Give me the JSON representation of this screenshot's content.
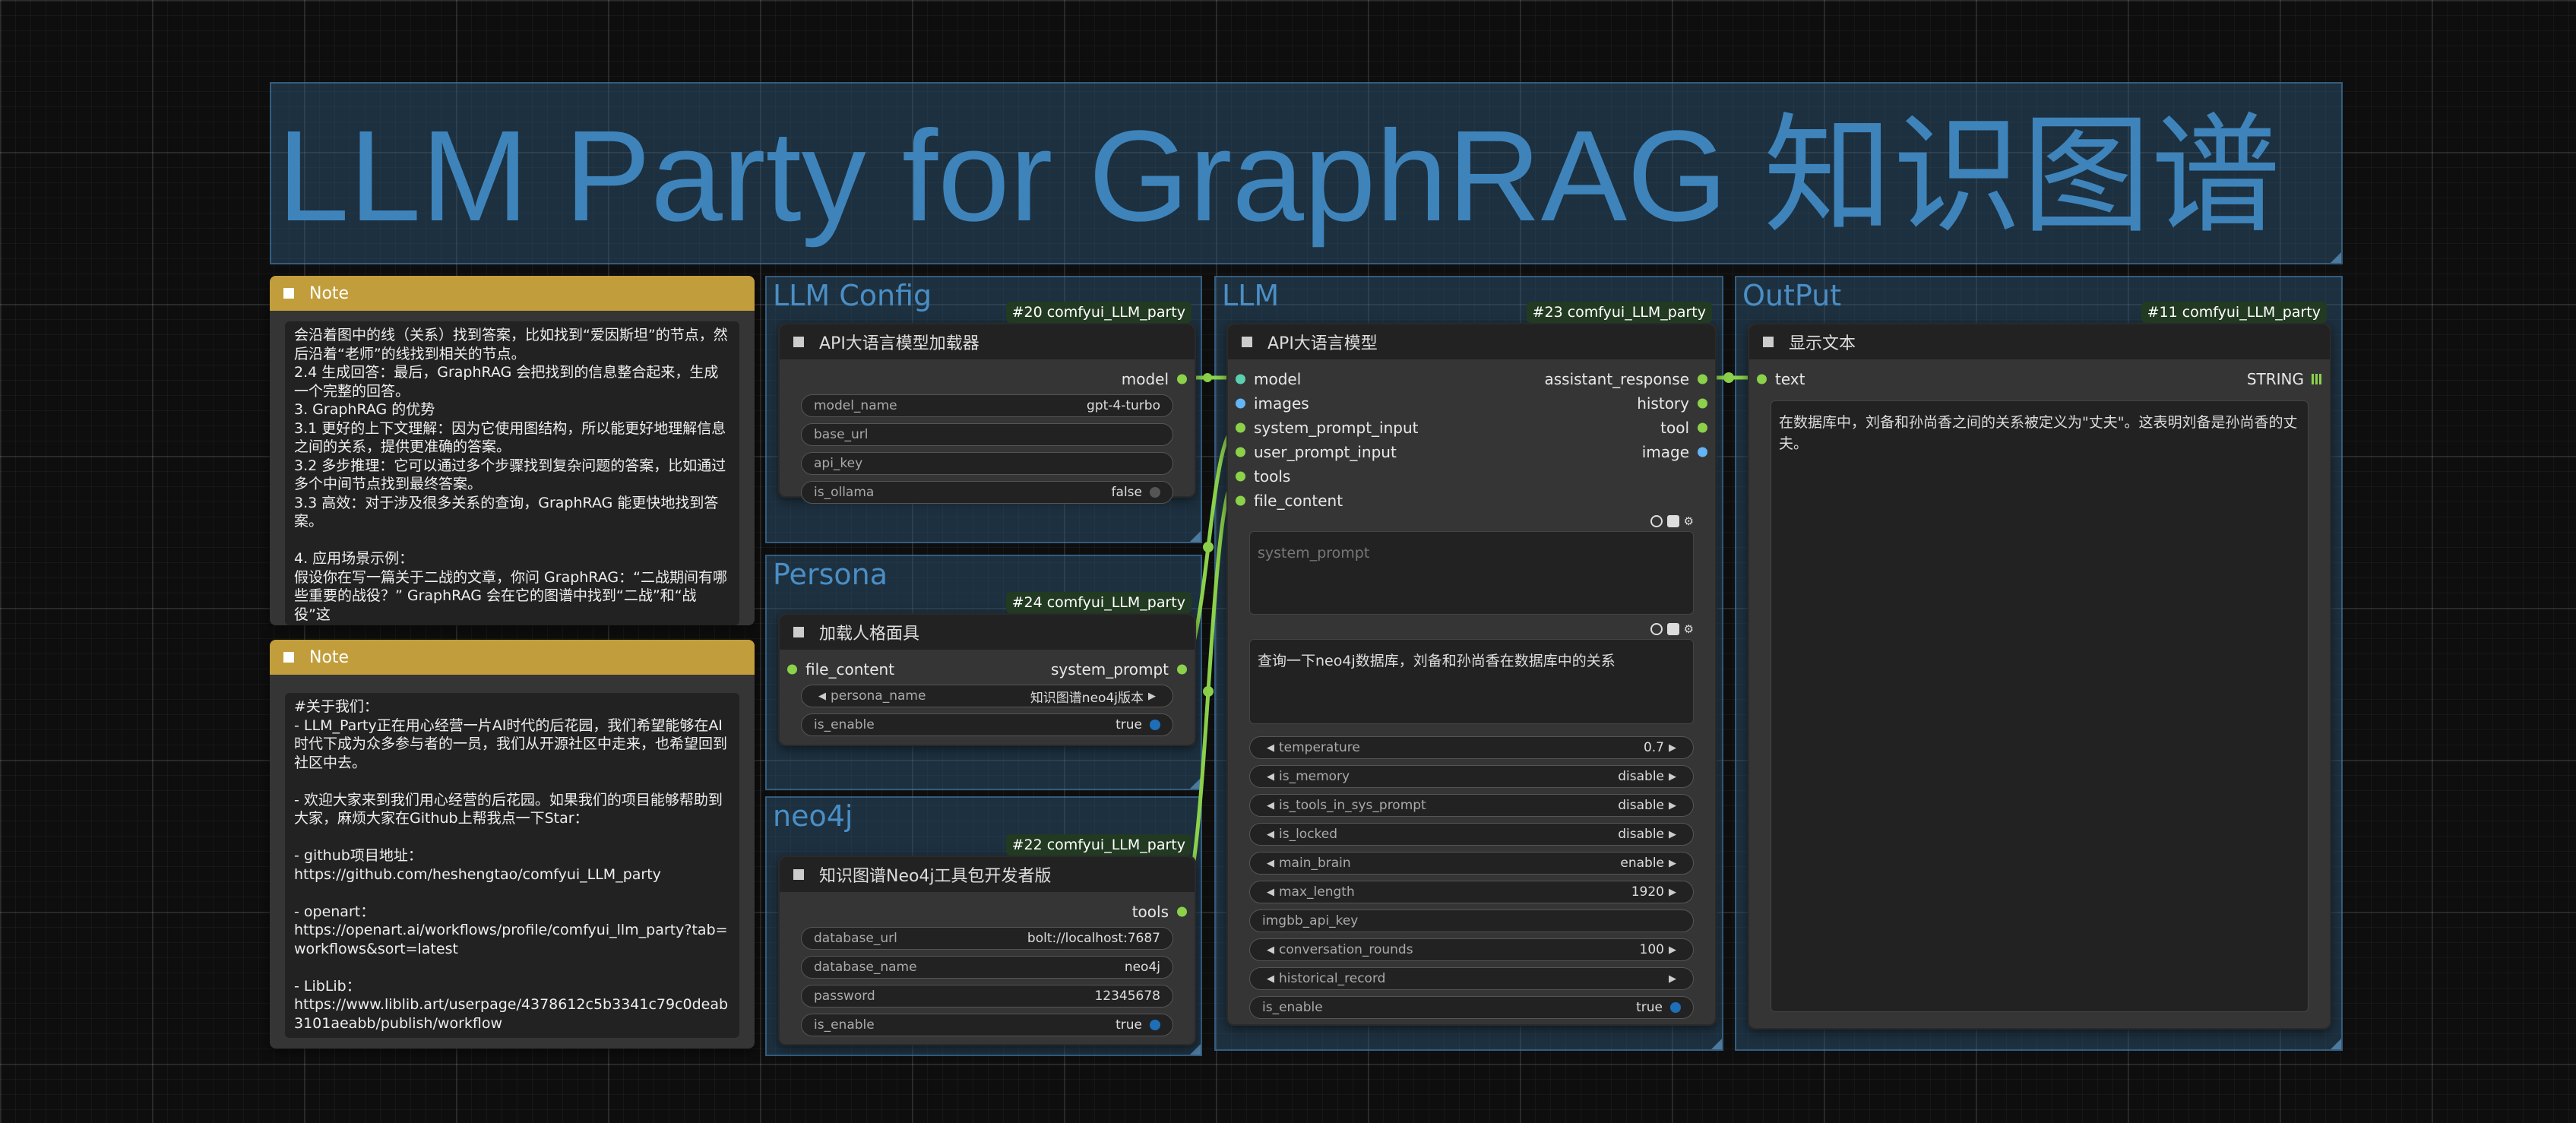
{
  "header": {
    "title": "LLM Party for GraphRAG 知识图谱"
  },
  "groups": {
    "llm_config": "LLM Config",
    "persona": "Persona",
    "neo4j": "neo4j",
    "llm": "LLM",
    "output": "OutPut"
  },
  "note1": {
    "title": "Note",
    "text": "会沿着图中的线（关系）找到答案，比如找到“爱因斯坦”的节点，然后沿着“老师”的线找到相关的节点。\n2.4 生成回答：最后，GraphRAG 会把找到的信息整合起来，生成一个完整的回答。\n3. GraphRAG 的优势\n3.1 更好的上下文理解：因为它使用图结构，所以能更好地理解信息之间的关系，提供更准确的答案。\n3.2 多步推理：它可以通过多个步骤找到复杂问题的答案，比如通过多个中间节点找到最终答案。\n3.3 高效：对于涉及很多关系的查询，GraphRAG 能更快地找到答案。\n\n4. 应用场景示例：\n假设你在写一篇关于二战的文章，你问 GraphRAG：“二战期间有哪些重要的战役？” GraphRAG 会在它的图谱中找到“二战”和“战役”这"
  },
  "note2": {
    "title": "Note",
    "text": "#关于我们：\n- LLM_Party正在用心经营一片AI时代的后花园，我们希望能够在AI时代下成为众多参与者的一员，我们从开源社区中走来，也希望回到社区中去。\n\n- 欢迎大家来到我们用心经营的后花园。如果我们的项目能够帮助到大家，麻烦大家在Github上帮我点一下Star：\n\n- github项目地址：\nhttps://github.com/heshengtao/comfyui_LLM_party\n\n- openart：\nhttps://openart.ai/workflows/profile/comfyui_llm_party?tab=workflows&sort=latest\n\n- LibLib：\nhttps://www.liblib.art/userpage/4378612c5b3341c79c0deab3101aeabb/publish/workflow"
  },
  "node20": {
    "badge": "#20 comfyui_LLM_party",
    "title": "API大语言模型加载器",
    "output": "model",
    "widgets": [
      {
        "label": "model_name",
        "value": "gpt-4-turbo"
      },
      {
        "label": "base_url",
        "value": ""
      },
      {
        "label": "api_key",
        "value": ""
      },
      {
        "label": "is_ollama",
        "value": "false"
      }
    ]
  },
  "node24": {
    "badge": "#24 comfyui_LLM_party",
    "title": "加载人格面具",
    "input": "file_content",
    "output": "system_prompt",
    "widgets": [
      {
        "label": "persona_name",
        "value": "知识图谱neo4j版本"
      },
      {
        "label": "is_enable",
        "value": "true"
      }
    ]
  },
  "node22": {
    "badge": "#22 comfyui_LLM_party",
    "title": "知识图谱Neo4j工具包开发者版",
    "output": "tools",
    "widgets": [
      {
        "label": "database_url",
        "value": "bolt://localhost:7687"
      },
      {
        "label": "database_name",
        "value": "neo4j"
      },
      {
        "label": "password",
        "value": "12345678"
      },
      {
        "label": "is_enable",
        "value": "true"
      }
    ]
  },
  "node23": {
    "badge": "#23 comfyui_LLM_party",
    "title": "API大语言模型",
    "inputs": [
      "model",
      "images",
      "system_prompt_input",
      "user_prompt_input",
      "tools",
      "file_content"
    ],
    "outputs": [
      "assistant_response",
      "history",
      "tool",
      "image"
    ],
    "system_prompt_placeholder": "system_prompt",
    "user_prompt_value": "查询一下neo4j数据库，刘备和孙尚香在数据库中的关系",
    "widgets": [
      {
        "label": "temperature",
        "value": "0.7"
      },
      {
        "label": "is_memory",
        "value": "disable"
      },
      {
        "label": "is_tools_in_sys_prompt",
        "value": "disable"
      },
      {
        "label": "is_locked",
        "value": "disable"
      },
      {
        "label": "main_brain",
        "value": "enable"
      },
      {
        "label": "max_length",
        "value": "1920"
      },
      {
        "label": "imgbb_api_key",
        "value": ""
      },
      {
        "label": "conversation_rounds",
        "value": "100"
      },
      {
        "label": "historical_record",
        "value": ""
      },
      {
        "label": "is_enable",
        "value": "true"
      }
    ]
  },
  "node11": {
    "badge": "#11 comfyui_LLM_party",
    "title": "显示文本",
    "input": "text",
    "output": "STRING",
    "text": "在数据库中，刘备和孙尚香之间的关系被定义为\"丈夫\"。这表明刘备是孙尚香的丈夫。"
  },
  "colors": {
    "group_fill": "#335f82",
    "group_title": "#4a8ec5",
    "note_header": "#c29d3b",
    "node_body": "#353535",
    "node_header": "#222222",
    "socket_green": "#8bd14a",
    "socket_blue": "#64b5f6",
    "wire_green": "#8bd14a",
    "toggle_blue": "#1e6fb8",
    "toggle_off": "#555555"
  }
}
